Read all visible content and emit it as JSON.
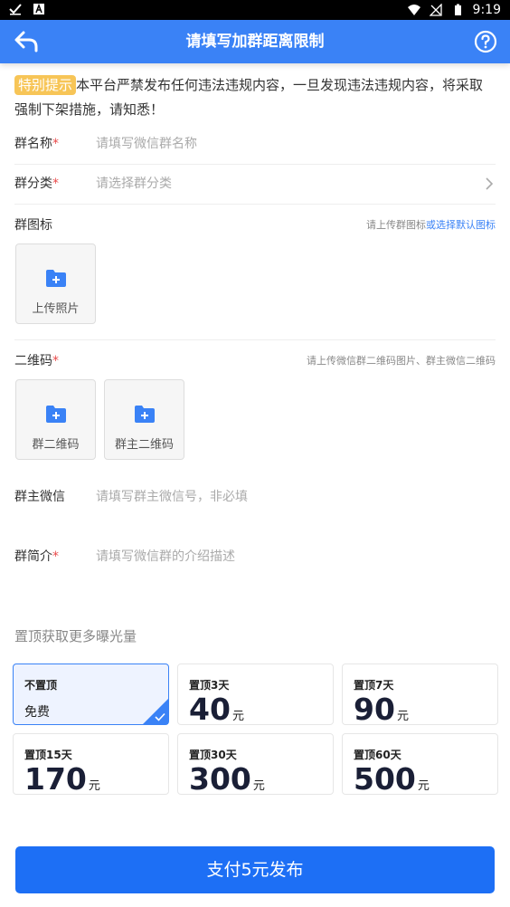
{
  "status_bar": {
    "time": "9:19"
  },
  "header": {
    "title": "请填写加群距离限制"
  },
  "notice": {
    "tag": "特别提示",
    "text": "本平台严禁发布任何违法违规内容，一旦发现违法违规内容，将采取强制下架措施，请知悉！"
  },
  "form": {
    "group_name": {
      "label": "群名称",
      "required_mark": "*",
      "placeholder": "请填写微信群名称"
    },
    "group_category": {
      "label": "群分类",
      "required_mark": "*",
      "placeholder": "请选择群分类"
    },
    "group_icon": {
      "label": "群图标",
      "hint": "请上传群图标",
      "hint_link": "或选择默认图标",
      "upload_label": "上传照片"
    },
    "qrcode": {
      "label": "二维码",
      "required_mark": "*",
      "hint": "请上传微信群二维码图片、群主微信二维码",
      "upload_group": "群二维码",
      "upload_owner": "群主二维码"
    },
    "owner_wechat": {
      "label": "群主微信",
      "placeholder": "请填写群主微信号，非必填"
    },
    "intro": {
      "label": "群简介",
      "required_mark": "*",
      "placeholder": "请填写微信群的介绍描述"
    }
  },
  "pinning": {
    "title": "置顶获取更多曝光量",
    "options": [
      {
        "title": "不置顶",
        "value": "免费",
        "selected": true
      },
      {
        "title": "置顶3天",
        "value": "40",
        "unit": "元"
      },
      {
        "title": "置顶7天",
        "value": "90",
        "unit": "元"
      },
      {
        "title": "置顶15天",
        "value": "170",
        "unit": "元"
      },
      {
        "title": "置顶30天",
        "value": "300",
        "unit": "元"
      },
      {
        "title": "置顶60天",
        "value": "500",
        "unit": "元"
      }
    ]
  },
  "footer": {
    "pay_button": "支付5元发布"
  },
  "colors": {
    "primary": "#3a82f6",
    "pay_button": "#1d6ff5",
    "tag": "#f7c557",
    "required": "#e94b4b"
  }
}
